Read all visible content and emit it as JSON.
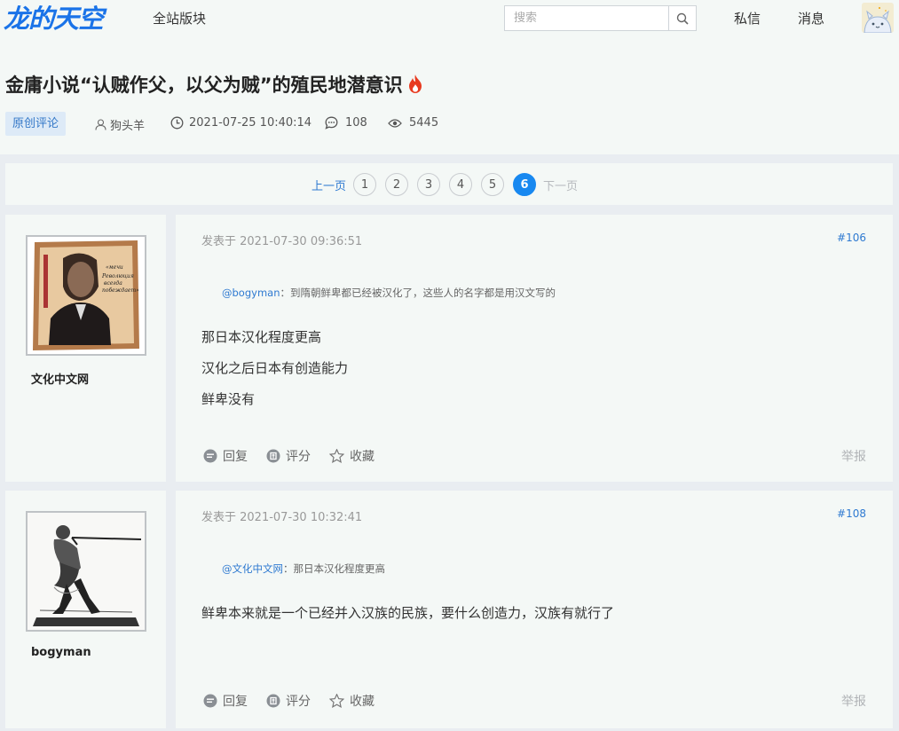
{
  "nav": {
    "logo": "龙的天空",
    "all_boards": "全站版块",
    "search_placeholder": "搜索",
    "messages": "私信",
    "notifications": "消息"
  },
  "thread": {
    "title": "金庸小说“认贼作父，以父为贼”的殖民地潜意识",
    "tag": "原创评论",
    "author": "狗头羊",
    "datetime": "2021-07-25 10:40:14",
    "comments": "108",
    "views": "5445"
  },
  "pager": {
    "prev": "上一页",
    "pages": [
      "1",
      "2",
      "3",
      "4",
      "5",
      "6"
    ],
    "current": "6",
    "next": "下一页"
  },
  "posts": [
    {
      "username": "文化中文网",
      "time": "发表于 2021-07-30 09:36:51",
      "floor": "#106",
      "quote_at": "@bogyman",
      "quote_text": "：到隋朝鲜卑都已经被汉化了，这些人的名字都是用汉文写的",
      "lines": [
        "那日本汉化程度更高",
        "汉化之后日本有创造能力",
        "鲜卑没有"
      ],
      "avatar_caption": "«мечи Революция всегда побеждает»"
    },
    {
      "username": "bogyman",
      "time": "发表于 2021-07-30 10:32:41",
      "floor": "#108",
      "quote_at": "@文化中文网",
      "quote_text": "：那日本汉化程度更高",
      "lines": [
        "鲜卑本来就是一个已经并入汉族的民族，要什么创造力，汉族有就行了"
      ]
    }
  ],
  "actions": {
    "reply": "回复",
    "rate": "评分",
    "favorite": "收藏",
    "report": "举报"
  },
  "colors": {
    "accent": "#1888f0",
    "link": "#2f7ad1",
    "logo": "#1a73e8",
    "flame": "#e83a1f"
  }
}
